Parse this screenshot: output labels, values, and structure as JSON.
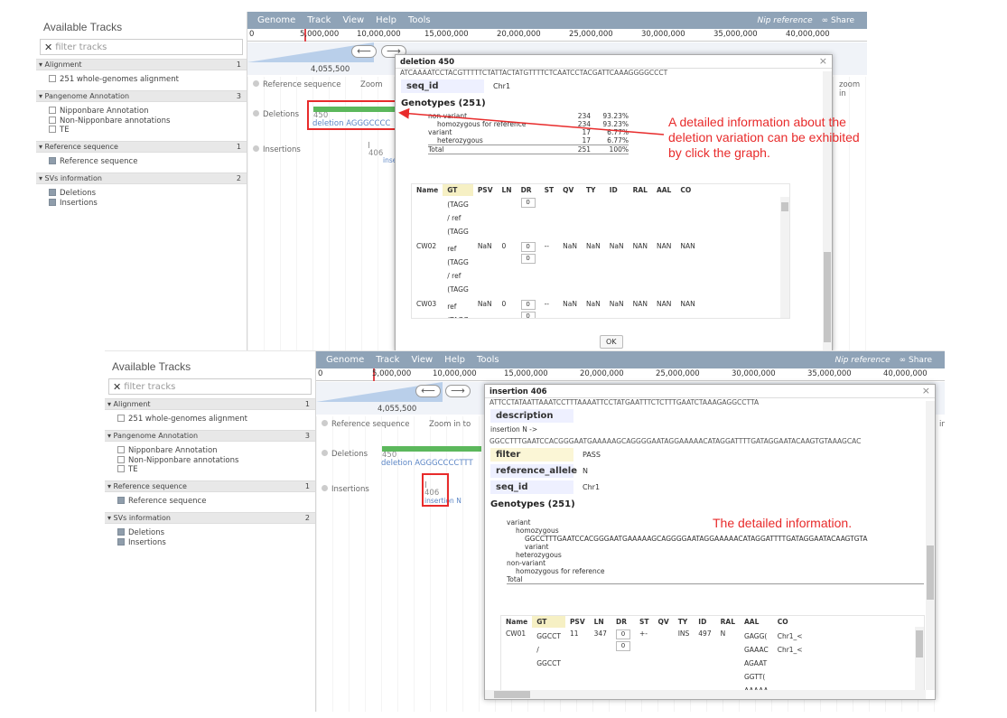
{
  "shot1": {
    "left_panel": {
      "title": "Available Tracks",
      "filter_placeholder": "filter tracks",
      "categories": [
        {
          "label": "Alignment",
          "count": "1",
          "items": [
            {
              "label": "251 whole-genomes alignment",
              "checked": false
            }
          ]
        },
        {
          "label": "Pangenome Annotation",
          "count": "3",
          "items": [
            {
              "label": "Nipponbare Annotation",
              "checked": false
            },
            {
              "label": "Non-Nipponbare annotations",
              "checked": false
            },
            {
              "label": "TE",
              "checked": false
            }
          ]
        },
        {
          "label": "Reference sequence",
          "count": "1",
          "items": [
            {
              "label": "Reference sequence",
              "checked": true
            }
          ]
        },
        {
          "label": "SVs information",
          "count": "2",
          "items": [
            {
              "label": "Deletions",
              "checked": true
            },
            {
              "label": "Insertions",
              "checked": true
            }
          ]
        }
      ]
    },
    "menu": {
      "genome": "Genome",
      "track": "Track",
      "view": "View",
      "help": "Help",
      "tools": "Tools",
      "reference": "Nip reference",
      "share": "Share"
    },
    "ruler_ticks": [
      "0",
      "5,000,000",
      "10,000,000",
      "15,000,000",
      "20,000,000",
      "25,000,000",
      "30,000,000",
      "35,000,000",
      "40,000,000"
    ],
    "coordinate": "4,055,500",
    "track_labels": {
      "reference": "Reference sequence",
      "zoom_out": "Zoom",
      "zoom_in": "zoom in",
      "deletions": "Deletions",
      "insertions": "Insertions"
    },
    "features": {
      "deletion_num": "450",
      "deletion_label": "deletion AGGGCCCC",
      "insertion_num": "406",
      "insertion_label": "insertio"
    },
    "dialog": {
      "title": "deletion 450",
      "sequence": "ATCAAAATCCTACGTTTTTCTATTACTATGTTTTCTCAATCCTACGATTCAAAGGGGCCCT",
      "seq_id_label": "seq_id",
      "seq_id_value": "Chr1",
      "genotypes_heading": "Genotypes (251)",
      "summary": [
        {
          "label": "non-variant",
          "count": "234",
          "pct": "93.23%",
          "indent": 0
        },
        {
          "label": "homozygous for reference",
          "count": "234",
          "pct": "93.23%",
          "indent": 1
        },
        {
          "label": "variant",
          "count": "17",
          "pct": "6.77%",
          "indent": 0
        },
        {
          "label": "heterozygous",
          "count": "17",
          "pct": "6.77%",
          "indent": 1
        },
        {
          "label": "Total",
          "count": "251",
          "pct": "100%",
          "indent": 0
        }
      ],
      "columns": [
        "Name",
        "GT",
        "PSV",
        "LN",
        "DR",
        "ST",
        "QV",
        "TY",
        "ID",
        "RAL",
        "AAL",
        "CO"
      ],
      "rows": [
        {
          "name": "",
          "gt": [
            "(TAGG",
            "/ ref",
            "(TAGG"
          ],
          "psv": "",
          "ln": "",
          "dr": [
            "0"
          ],
          "st": "",
          "qv": "",
          "ty": "",
          "id": "",
          "ral": "",
          "aal": "",
          "co": ""
        },
        {
          "name": "CW02",
          "gt": [
            "ref",
            "(TAGG",
            "/ ref",
            "(TAGG"
          ],
          "psv": "NaN",
          "ln": "0",
          "dr": [
            "0",
            "0"
          ],
          "st": "--",
          "qv": "NaN",
          "ty": "NaN",
          "id": "NaN",
          "ral": "NAN",
          "aal": "NAN",
          "co": "NAN"
        },
        {
          "name": "CW03",
          "gt": [
            "ref",
            "(TAGG",
            "/ ref",
            "(TAGG"
          ],
          "psv": "NaN",
          "ln": "0",
          "dr": [
            "0",
            "0"
          ],
          "st": "--",
          "qv": "NaN",
          "ty": "NaN",
          "id": "NaN",
          "ral": "NAN",
          "aal": "NAN",
          "co": "NAN"
        }
      ],
      "ok": "OK"
    },
    "annotation": "A detailed information about the deletion variation can be exhibited by click the graph."
  },
  "shot2": {
    "left_panel": {
      "title": "Available Tracks",
      "filter_placeholder": "filter tracks",
      "categories": [
        {
          "label": "Alignment",
          "count": "1",
          "items": [
            {
              "label": "251 whole-genomes alignment",
              "checked": false
            }
          ]
        },
        {
          "label": "Pangenome Annotation",
          "count": "3",
          "items": [
            {
              "label": "Nipponbare Annotation",
              "checked": false
            },
            {
              "label": "Non-Nipponbare annotations",
              "checked": false
            },
            {
              "label": "TE",
              "checked": false
            }
          ]
        },
        {
          "label": "Reference sequence",
          "count": "1",
          "items": [
            {
              "label": "Reference sequence",
              "checked": true
            }
          ]
        },
        {
          "label": "SVs information",
          "count": "2",
          "items": [
            {
              "label": "Deletions",
              "checked": true
            },
            {
              "label": "Insertions",
              "checked": true
            }
          ]
        }
      ]
    },
    "menu": {
      "genome": "Genome",
      "track": "Track",
      "view": "View",
      "help": "Help",
      "tools": "Tools",
      "reference": "Nip reference",
      "share": "Share"
    },
    "ruler_ticks": [
      "0",
      "5,000,000",
      "10,000,000",
      "15,000,000",
      "20,000,000",
      "25,000,000",
      "30,000,000",
      "35,000,000",
      "40,000,000"
    ],
    "coordinate": "4,055,500",
    "track_labels": {
      "reference": "Reference sequence",
      "zoom_out": "Zoom in to",
      "zoom_in": "in",
      "deletions": "Deletions",
      "insertions": "Insertions"
    },
    "features": {
      "deletion_num": "450",
      "deletion_label": "deletion AGGGCCCCTTT",
      "insertion_num": "406",
      "insertion_label": "insertion N"
    },
    "dialog": {
      "title": "insertion 406",
      "sequence": "ATTCCTATAATTAAATCCTTTAAAATTCCTATGAATTTCTCTTTGAATCTAAAGAGGCCTTA",
      "description_label": "description",
      "description_value": "insertion N ->",
      "insertion_seq": "GGCCTTTGAATCCACGGGAATGAAAAAGCAGGGGAATAGGAAAAACATAGGATTTTGATAGGAATACAAGTGTAAAGCAC",
      "filter_label": "filter",
      "filter_value": "PASS",
      "ref_allele_label": "reference_allele",
      "ref_allele_value": "N",
      "seq_id_label": "seq_id",
      "seq_id_value": "Chr1",
      "genotypes_heading": "Genotypes (251)",
      "summary": [
        {
          "label": "variant",
          "indent": 0
        },
        {
          "label": "homozygous",
          "indent": 1
        },
        {
          "label": "GGCCTTTGAATCCACGGGAATGAAAAAGCAGGGGAATAGGAAAAACATAGGATTTTGATAGGAATACAAGTGTA",
          "indent": 2
        },
        {
          "label": "variant",
          "indent": 2
        },
        {
          "label": "heterozygous",
          "indent": 1
        },
        {
          "label": "non-variant",
          "indent": 0
        },
        {
          "label": "homozygous for reference",
          "indent": 1
        },
        {
          "label": "Total",
          "indent": 0
        }
      ],
      "columns": [
        "Name",
        "GT",
        "PSV",
        "LN",
        "DR",
        "ST",
        "QV",
        "TY",
        "ID",
        "RAL",
        "AAL",
        "CO"
      ],
      "rows": [
        {
          "name": "CW01",
          "gt": [
            "GGCCT",
            "/",
            "GGCCT"
          ],
          "psv": "11",
          "ln": "347",
          "dr": [
            "0",
            "0"
          ],
          "st": "+-",
          "qv": "",
          "ty": "INS",
          "id": "497",
          "ral": "N",
          "aal": [
            "GAGG(",
            "GAAAC",
            "AGAAT",
            "GGTT(",
            "AAAAA"
          ],
          "co": [
            "Chr1_<",
            "Chr1_<"
          ]
        }
      ]
    },
    "annotation": "The detailed information."
  },
  "colors": {
    "menubar": "#8fa3b7",
    "feature": "#5cb85c",
    "annotation": "#e82b2b",
    "label_blue": "#5b85c5"
  }
}
